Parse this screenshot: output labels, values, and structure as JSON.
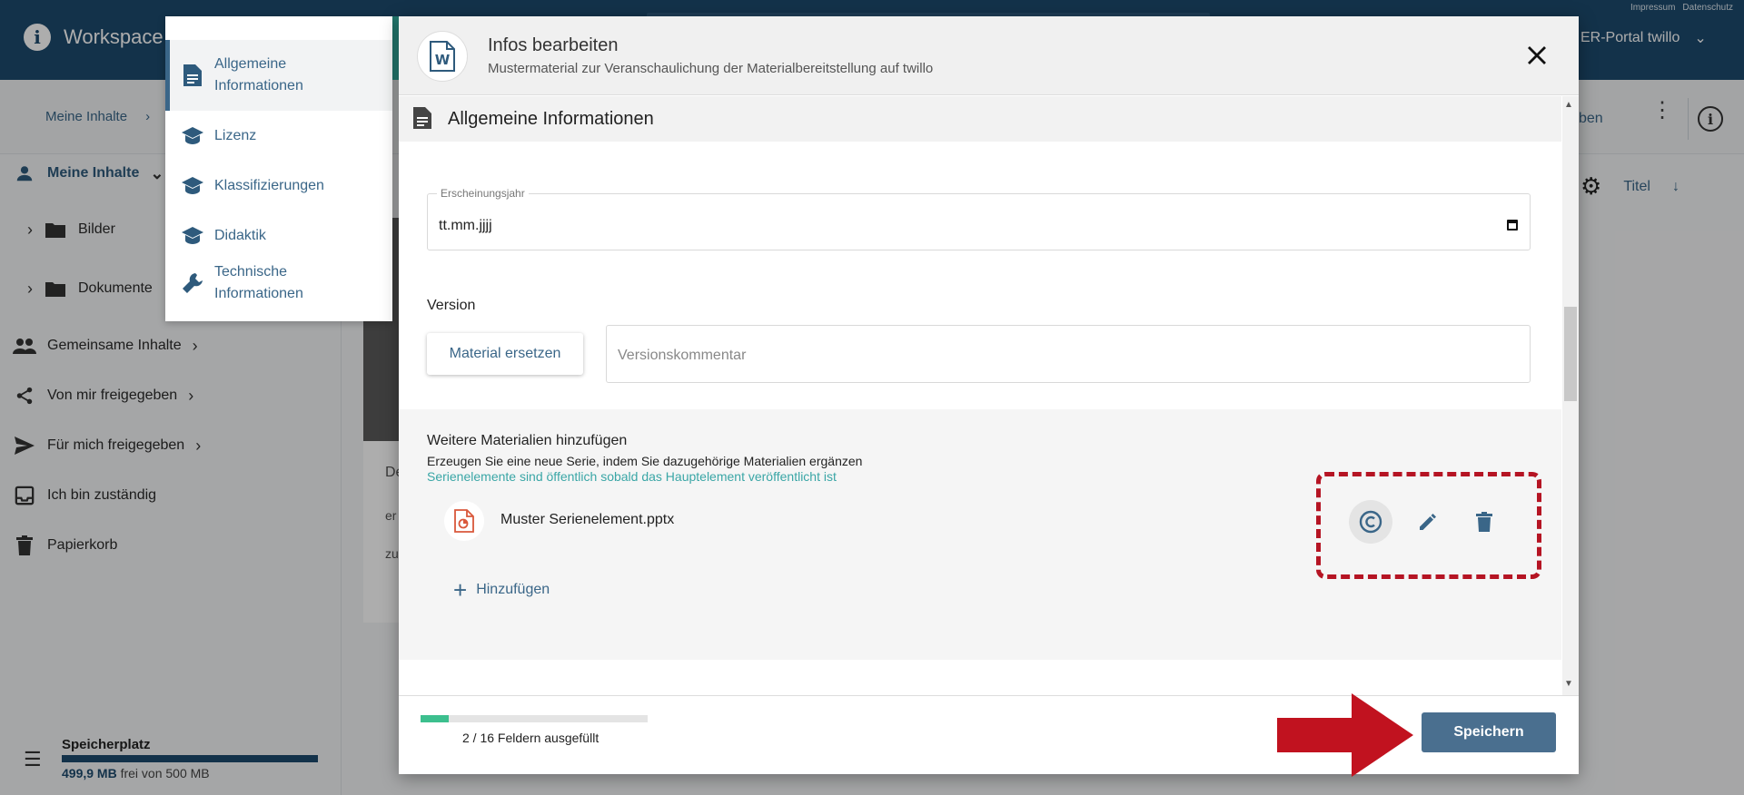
{
  "app": {
    "brand": "Workspace",
    "top_links": [
      "Impressum",
      "Datenschutz"
    ],
    "portal": "ER-Portal twillo",
    "breadcrumb": "Meine Inhalte",
    "sub_right_text": "ben",
    "sort_label": "Titel"
  },
  "sidebar": {
    "items": [
      {
        "label": "Meine Inhalte",
        "icon": "person-icon"
      },
      {
        "label": "Bilder",
        "icon": "folder-icon"
      },
      {
        "label": "Dokumente",
        "icon": "folder-icon"
      },
      {
        "label": "Gemeinsame Inhalte",
        "icon": "group-icon"
      },
      {
        "label": "Von mir freigegeben",
        "icon": "share-icon"
      },
      {
        "label": "Für mich freigegeben",
        "icon": "send-icon"
      },
      {
        "label": "Ich bin zuständig",
        "icon": "inbox-icon"
      },
      {
        "label": "Papierkorb",
        "icon": "trash-icon"
      }
    ],
    "storage": {
      "title": "Speicherplatz",
      "used": "499,9 MB",
      "rest": "frei von 500 MB",
      "fraction_free": 0.9998
    }
  },
  "card_fragments": [
    "De",
    "er",
    "zu"
  ],
  "nav_menu": {
    "items": [
      {
        "label": "Allgemeine Informationen",
        "icon": "document-icon",
        "active": true
      },
      {
        "label": "Lizenz",
        "icon": "graduation-cap-icon"
      },
      {
        "label": "Klassifizierungen",
        "icon": "graduation-cap-icon"
      },
      {
        "label": "Didaktik",
        "icon": "graduation-cap-icon"
      },
      {
        "label": "Technische Informationen",
        "icon": "wrench-icon"
      }
    ]
  },
  "dialog": {
    "title": "Infos bearbeiten",
    "subtitle": "Mustermaterial zur Veranschaulichung der Materialbereitstellung auf twillo",
    "section_title": "Allgemeine Informationen",
    "year_field": {
      "label": "Erscheinungsjahr",
      "value": "tt.mm.jjjj"
    },
    "version": {
      "label": "Version",
      "replace_button": "Material ersetzen",
      "comment_placeholder": "Versionskommentar"
    },
    "series": {
      "title": "Weitere Materialien hinzufügen",
      "description": "Erzeugen Sie eine neue Serie, indem Sie dazugehörige Materialien ergänzen",
      "note": "Serienelemente sind öffentlich sobald das Hauptelement veröffentlicht ist",
      "item_name": "Muster Serienelement.pptx",
      "add_label": "Hinzufügen"
    },
    "footer": {
      "progress_text": "2 / 16 Feldern ausgefüllt",
      "progress_fraction": 0.125,
      "save_label": "Speichern"
    }
  },
  "colors": {
    "primary": "#3a6688",
    "topbar": "#1d4a6e",
    "highlight": "#b51423",
    "progress": "#3cbf8e",
    "save_button": "#4a6f8f"
  }
}
